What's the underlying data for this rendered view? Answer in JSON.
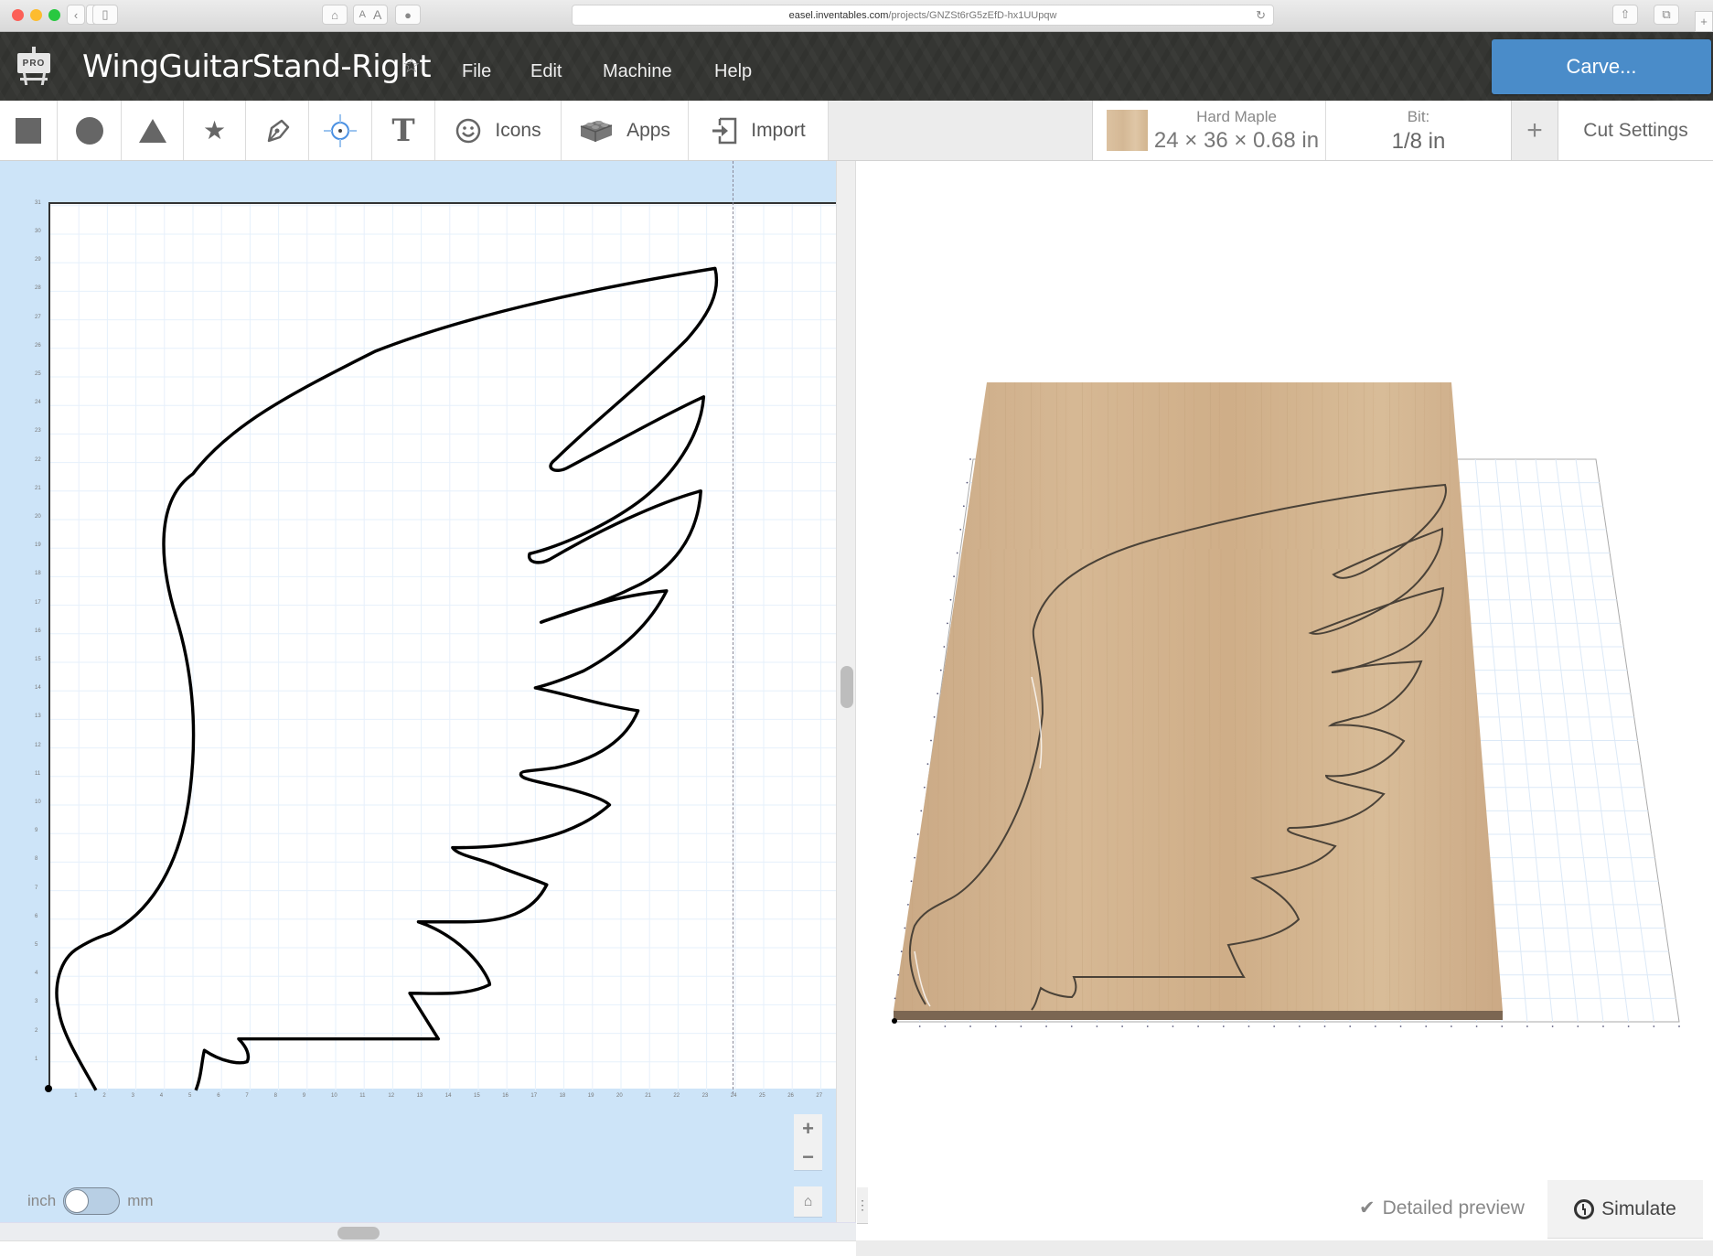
{
  "browser": {
    "url_host": "easel.inventables.com",
    "url_path": "/projects/GNZSt6rG5zEfD-hx1UUpqw",
    "text_small": "A",
    "text_large": "A"
  },
  "header": {
    "logo_badge": "PRO",
    "project_title": "WingGuitarStand-Right",
    "favorite_icon": "☆",
    "menu": [
      {
        "label": "File"
      },
      {
        "label": "Edit"
      },
      {
        "label": "Machine"
      },
      {
        "label": "Help"
      }
    ],
    "carve_label": "Carve..."
  },
  "toolbar": {
    "tools": [
      {
        "name": "rectangle-tool",
        "icon": "square"
      },
      {
        "name": "circle-tool",
        "icon": "circle"
      },
      {
        "name": "triangle-tool",
        "icon": "triangle"
      },
      {
        "name": "star-tool",
        "icon": "star"
      },
      {
        "name": "pen-tool",
        "icon": "pen"
      },
      {
        "name": "point-tool",
        "icon": "crosshair",
        "active": true
      },
      {
        "name": "text-tool",
        "icon": "T"
      }
    ],
    "icons_label": "Icons",
    "apps_label": "Apps",
    "import_label": "Import",
    "material": {
      "name": "Hard Maple",
      "dimensions": "24 × 36 × 0.68 in"
    },
    "bit": {
      "label": "Bit:",
      "value": "1/8 in"
    },
    "add_bit": "+",
    "cut_settings_label": "Cut Settings"
  },
  "canvas": {
    "x_axis_labels": [
      "1",
      "2",
      "3",
      "4",
      "5",
      "6",
      "7",
      "8",
      "9",
      "10",
      "11",
      "12",
      "13",
      "14",
      "15",
      "16",
      "17",
      "18",
      "19",
      "20",
      "21",
      "22",
      "23",
      "24",
      "25",
      "26",
      "27"
    ],
    "y_axis_labels": [
      "1",
      "2",
      "3",
      "4",
      "5",
      "6",
      "7",
      "8",
      "9",
      "10",
      "11",
      "12",
      "13",
      "14",
      "15",
      "16",
      "17",
      "18",
      "19",
      "20",
      "21",
      "22",
      "23",
      "24",
      "25",
      "26",
      "27",
      "28",
      "29",
      "30",
      "31"
    ],
    "material_width_in": 24,
    "units": {
      "left": "inch",
      "right": "mm",
      "selected": "inch"
    },
    "zoom_in": "+",
    "zoom_out": "−"
  },
  "preview": {
    "detailed_preview_label": "Detailed preview",
    "detailed_preview_checked": true,
    "simulate_label": "Simulate"
  },
  "colors": {
    "accent": "#4a8cc9",
    "nav_bg": "#353633",
    "canvas_bg": "#cde4f8",
    "wood": "#d2b48f"
  }
}
